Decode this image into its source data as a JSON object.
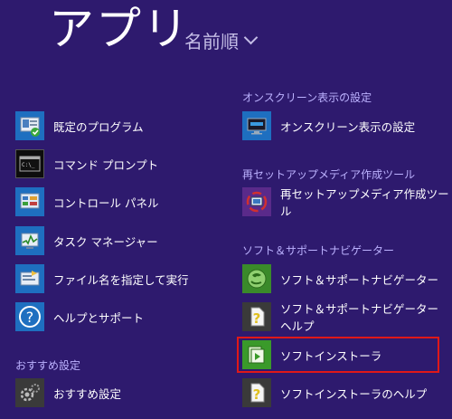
{
  "header": {
    "title": "アプリ",
    "sort_label": "名前順"
  },
  "groups": {
    "osusume": "おすすめ設定",
    "onscreen": "オンスクリーン表示の設定",
    "resetup": "再セットアップメディア作成ツール",
    "soft_support": "ソフト＆サポートナビゲーター"
  },
  "items": {
    "default_programs": "既定のプログラム",
    "command_prompt": "コマンド プロンプト",
    "control_panel": "コントロール パネル",
    "task_manager": "タスク マネージャー",
    "run": "ファイル名を指定して実行",
    "help_support": "ヘルプとサポート",
    "osusume_settings": "おすすめ設定",
    "onscreen_settings": "オンスクリーン表示の設定",
    "resetup_tool": "再セットアップメディア作成ツール",
    "soft_support_navi": "ソフト＆サポートナビゲーター",
    "soft_support_navi_help": "ソフト＆サポートナビゲーター ヘルプ",
    "soft_installer": "ソフトインストーラ",
    "soft_installer_help": "ソフトインストーラのヘルプ"
  },
  "colors": {
    "background": "#2e1a6e",
    "tile_blue": "#1e6fc0",
    "tile_dark": "#0d0d0d",
    "tile_gray": "#3a3a3a",
    "tile_green": "#3a8a2a",
    "selection_border": "#e01818"
  }
}
